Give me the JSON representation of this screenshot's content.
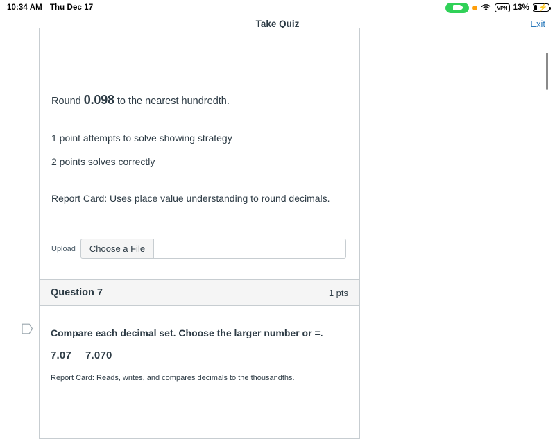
{
  "statusbar": {
    "time": "10:34 AM",
    "date": "Thu Dec 17",
    "battery_percent": "13%",
    "vpn_label": "VPN",
    "icons": {
      "screen_recording": "screen-recording-pill-icon",
      "microphone_in_use": "orange-dot-icon",
      "wifi": "wifi-icon",
      "vpn": "vpn-badge-icon",
      "battery": "battery-charging-icon"
    },
    "colors": {
      "recording_green": "#30d158",
      "mic_orange": "#ff9f0a"
    }
  },
  "appbar": {
    "title": "Take Quiz",
    "exit_label": "Exit",
    "link_color": "#2b7abc"
  },
  "questions": [
    {
      "prompt_prefix": "Round ",
      "prompt_value": "0.098",
      "prompt_suffix": " to the nearest hundredth.",
      "rubric_line_1": "1 point attempts to solve showing strategy",
      "rubric_line_2": "2 points solves correctly",
      "report_card": "Report Card: Uses place value understanding to round decimals.",
      "upload_label": "Upload",
      "file_button_label": "Choose a File",
      "file_field_value": ""
    },
    {
      "header_title": "Question 7",
      "points": "1 pts",
      "prompt": "Compare each decimal set. Choose the larger number or =.",
      "value_left": "7.07",
      "value_right": "7.070",
      "report_card": "Report Card: Reads, writes, and compares decimals to the thousandths."
    }
  ]
}
